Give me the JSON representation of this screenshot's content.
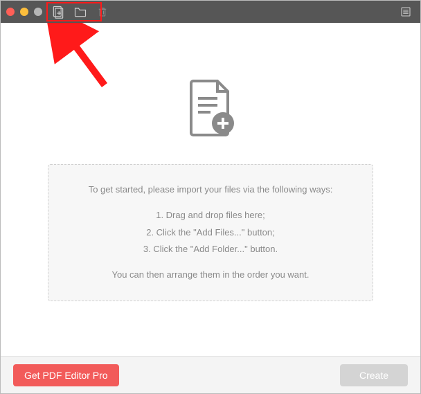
{
  "instructions": {
    "intro": "To get started, please import your files via the following ways:",
    "step1": "1. Drag and drop files here;",
    "step2": "2. Click the \"Add Files...\" button;",
    "step3": "3. Click the \"Add Folder...\" button.",
    "outro": "You can then arrange them in the order you want."
  },
  "footer": {
    "promo_label": "Get PDF Editor Pro",
    "create_label": "Create"
  }
}
